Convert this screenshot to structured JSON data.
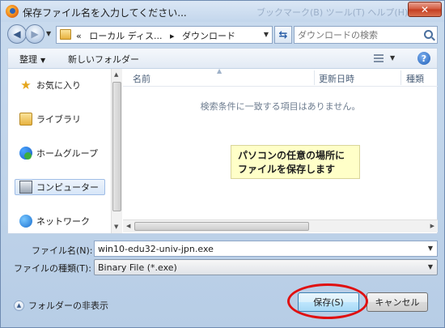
{
  "titlebar": {
    "title": "保存ファイル名を入力してください...",
    "ghost_menu": "ブックマーク(B)   ツール(T)   ヘルプ(H)",
    "close_label": "✕"
  },
  "address": {
    "crumb_chevrons": "«",
    "crumb_1": "ローカル ディス...",
    "crumb_sep": "▸",
    "crumb_2": "ダウンロード",
    "search_placeholder": "ダウンロードの検索"
  },
  "toolbar": {
    "organize_label": "整理",
    "new_folder_label": "新しいフォルダー"
  },
  "nav": {
    "items": [
      {
        "label": "お気に入り"
      },
      {
        "label": "ライブラリ"
      },
      {
        "label": "ホームグループ"
      },
      {
        "label": "コンピューター"
      },
      {
        "label": "ネットワーク"
      }
    ]
  },
  "file_list": {
    "columns": [
      "名前",
      "更新日時",
      "種類"
    ],
    "empty_message": "検索条件に一致する項目はありません。"
  },
  "callout": {
    "line1": "パソコンの任意の場所に",
    "line2": "ファイルを保存します"
  },
  "form": {
    "file_name_label": "ファイル名(N):",
    "file_name_value": "win10-edu32-univ-jpn.exe",
    "file_type_label": "ファイルの種類(T):",
    "file_type_value": "Binary File (*.exe)"
  },
  "footer": {
    "hide_folders_label": "フォルダーの非表示",
    "save_label": "保存(S)",
    "cancel_label": "キャンセル"
  },
  "colors": {
    "annotation_ellipse": "#e01010",
    "callout_background": "#ffffc8"
  }
}
